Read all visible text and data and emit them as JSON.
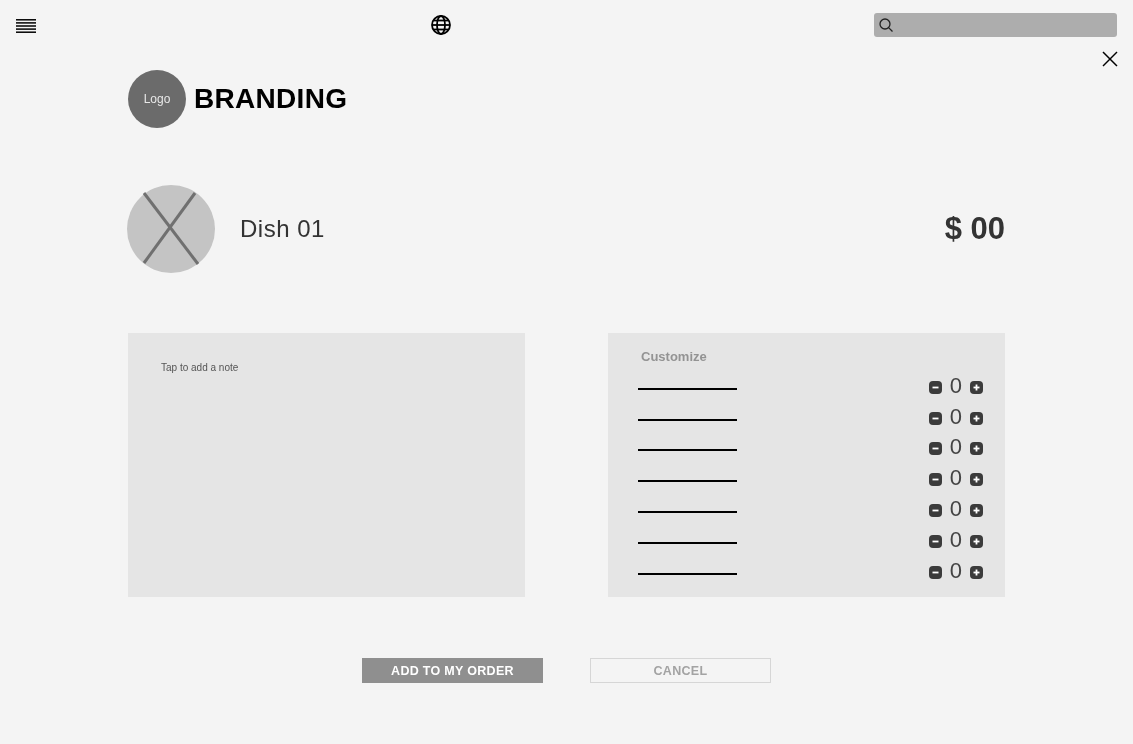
{
  "branding": {
    "logo": "Logo",
    "title": "BRANDING"
  },
  "dish": {
    "name": "Dish 01",
    "price": "$ 00"
  },
  "note": {
    "placeholder": "Tap to add a note"
  },
  "customize": {
    "title": "Customize",
    "options": [
      {
        "count": "0"
      },
      {
        "count": "0"
      },
      {
        "count": "0"
      },
      {
        "count": "0"
      },
      {
        "count": "0"
      },
      {
        "count": "0"
      },
      {
        "count": "0"
      }
    ]
  },
  "buttons": [
    {
      "label": "ADD TO MY ORDER",
      "kind": "filled",
      "disabled": false
    },
    {
      "label": "CANCEL",
      "kind": "outline",
      "disabled": true
    }
  ]
}
